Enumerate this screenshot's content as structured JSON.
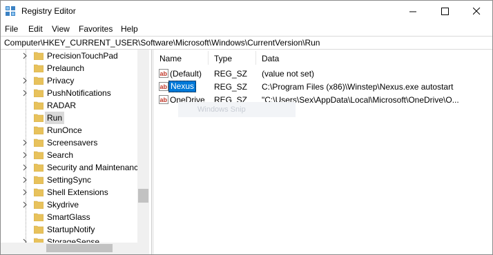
{
  "window": {
    "title": "Registry Editor",
    "controls": [
      "minimize",
      "maximize",
      "close"
    ]
  },
  "menu": [
    "File",
    "Edit",
    "View",
    "Favorites",
    "Help"
  ],
  "address": "Computer\\HKEY_CURRENT_USER\\Software\\Microsoft\\Windows\\CurrentVersion\\Run",
  "tree": {
    "items": [
      {
        "label": "PrecisionTouchPad",
        "expandable": true,
        "selected": false
      },
      {
        "label": "Prelaunch",
        "expandable": false,
        "selected": false
      },
      {
        "label": "Privacy",
        "expandable": true,
        "selected": false
      },
      {
        "label": "PushNotifications",
        "expandable": true,
        "selected": false
      },
      {
        "label": "RADAR",
        "expandable": false,
        "selected": false
      },
      {
        "label": "Run",
        "expandable": false,
        "selected": true
      },
      {
        "label": "RunOnce",
        "expandable": false,
        "selected": false
      },
      {
        "label": "Screensavers",
        "expandable": true,
        "selected": false
      },
      {
        "label": "Search",
        "expandable": true,
        "selected": false
      },
      {
        "label": "Security and Maintenance",
        "expandable": true,
        "selected": false
      },
      {
        "label": "SettingSync",
        "expandable": true,
        "selected": false
      },
      {
        "label": "Shell Extensions",
        "expandable": true,
        "selected": false
      },
      {
        "label": "Skydrive",
        "expandable": true,
        "selected": false
      },
      {
        "label": "SmartGlass",
        "expandable": false,
        "selected": false
      },
      {
        "label": "StartupNotify",
        "expandable": false,
        "selected": false
      },
      {
        "label": "StorageSense",
        "expandable": true,
        "selected": false
      }
    ]
  },
  "list": {
    "columns": [
      "Name",
      "Type",
      "Data"
    ],
    "rows": [
      {
        "name": "(Default)",
        "type": "REG_SZ",
        "data": "(value not set)",
        "selected": false
      },
      {
        "name": "Nexus",
        "type": "REG_SZ",
        "data": "C:\\Program Files (x86)\\Winstep\\Nexus.exe autostart",
        "selected": true
      },
      {
        "name": "OneDrive",
        "type": "REG_SZ",
        "data": "\"C:\\Users\\Sex\\AppData\\Local\\Microsoft\\OneDrive\\O...",
        "selected": false
      }
    ],
    "ghost_tooltip": "Windows Snip"
  },
  "colors": {
    "selection": "#0078d7",
    "tree_selection": "#d9d9d9",
    "folder": "#e8c25c",
    "ab_icon": "#c0392b"
  }
}
